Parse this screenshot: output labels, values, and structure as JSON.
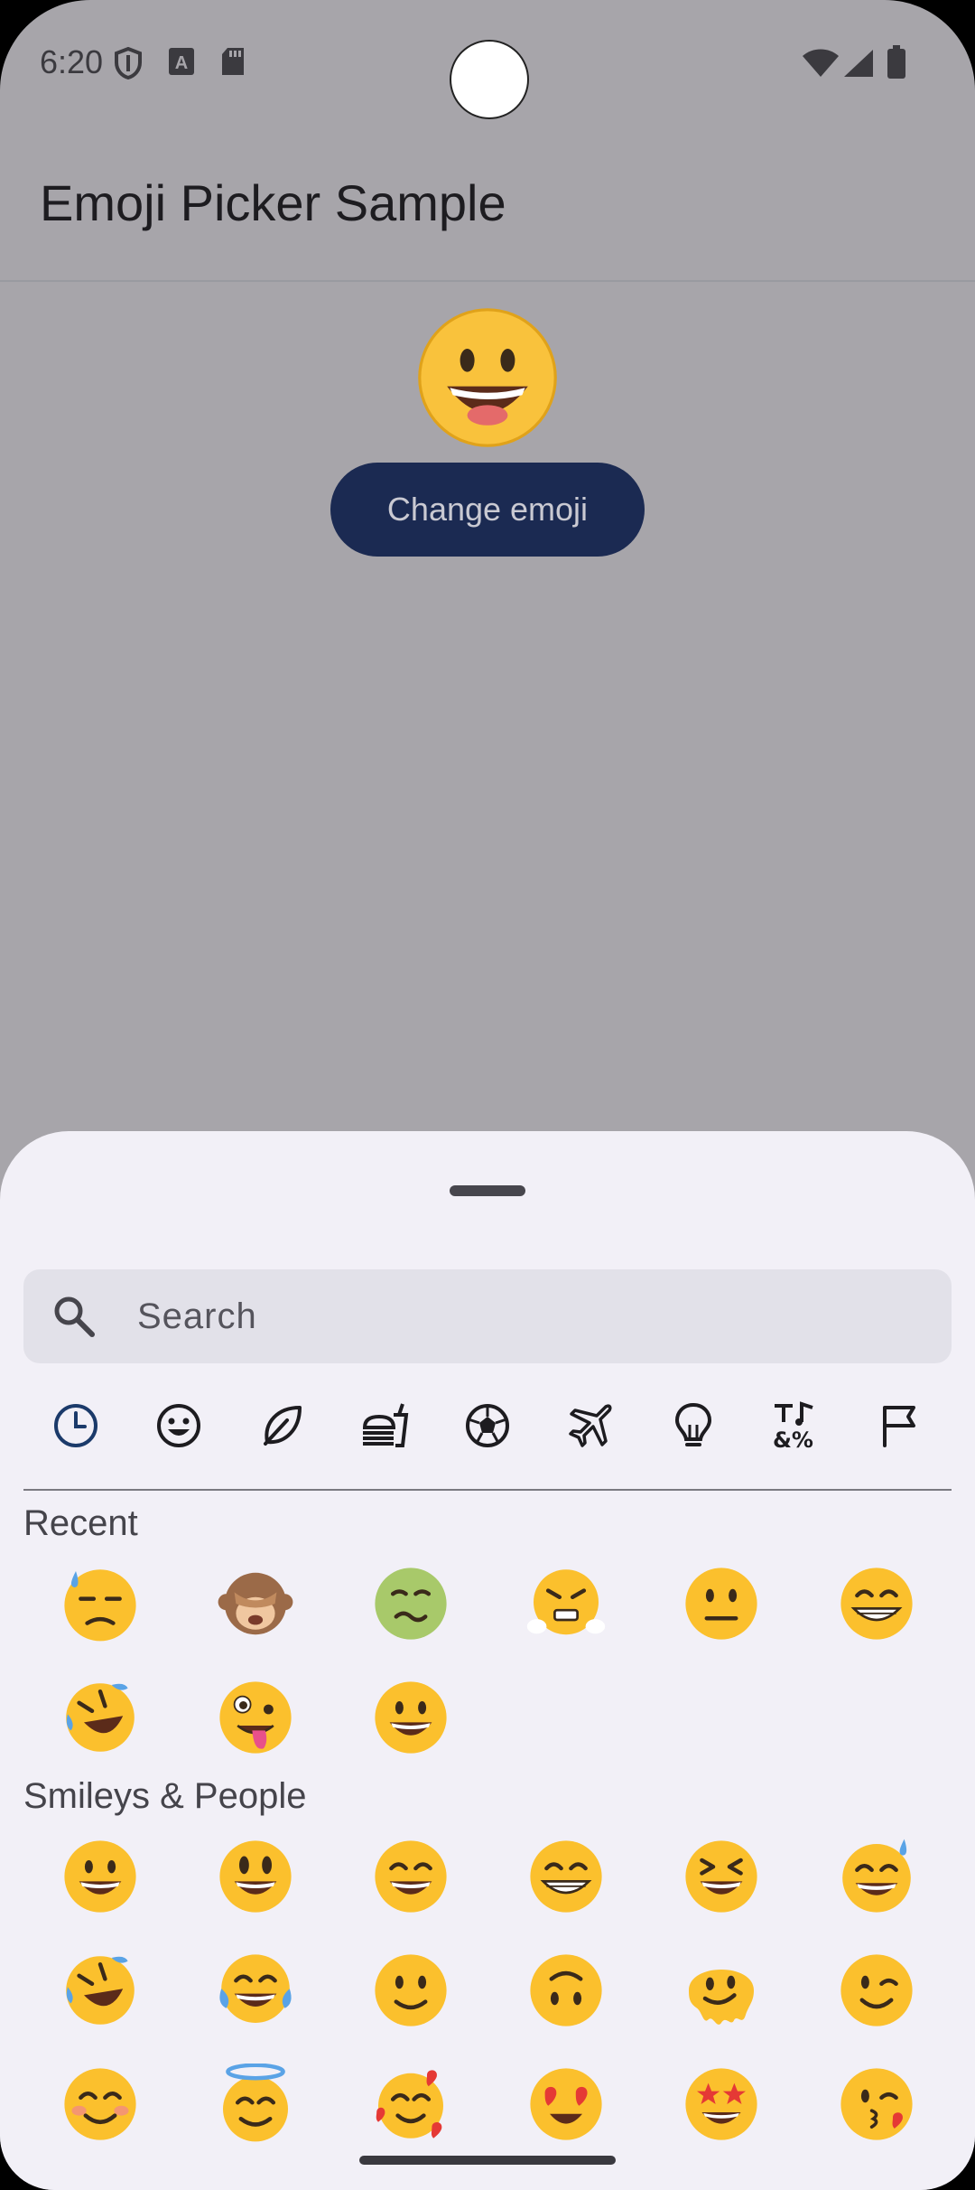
{
  "status_bar": {
    "time": "6:20",
    "left_icons": [
      "shield-icon",
      "font-download-icon",
      "sd-card-icon"
    ],
    "right_icons": [
      "wifi-icon",
      "cell-signal-icon",
      "battery-icon"
    ]
  },
  "app_bar": {
    "title": "Emoji Picker Sample"
  },
  "main": {
    "selected_emoji": "grinning-face",
    "change_button_label": "Change emoji",
    "button_color": "#1b2a52"
  },
  "sheet": {
    "search": {
      "placeholder": "Search"
    },
    "category_tabs": [
      {
        "name": "recent",
        "icon": "clock-icon",
        "selected": true
      },
      {
        "name": "smileys",
        "icon": "smiley-icon"
      },
      {
        "name": "nature",
        "icon": "leaf-icon"
      },
      {
        "name": "food",
        "icon": "food-icon"
      },
      {
        "name": "activities",
        "icon": "soccer-ball-icon"
      },
      {
        "name": "travel",
        "icon": "airplane-icon"
      },
      {
        "name": "objects",
        "icon": "lightbulb-icon"
      },
      {
        "name": "symbols",
        "icon": "symbols-icon"
      },
      {
        "name": "flags",
        "icon": "flag-icon"
      }
    ],
    "sections": [
      {
        "label": "Recent",
        "emojis": [
          "downcast-face-with-sweat",
          "see-no-evil-monkey",
          "nauseated-face",
          "face-with-steam",
          "neutral-face",
          "beaming-face",
          "rolling-on-floor-laughing",
          "zany-face",
          "grinning-face"
        ]
      },
      {
        "label": "Smileys & People",
        "emojis": [
          "grinning-face",
          "grinning-face-big-eyes",
          "grinning-face-smiling-eyes",
          "beaming-face",
          "grinning-squinting-face",
          "grinning-face-with-sweat",
          "rolling-on-floor-laughing",
          "face-with-tears-of-joy",
          "slightly-smiling-face",
          "upside-down-face",
          "melting-face",
          "winking-face",
          "smiling-face-smiling-eyes",
          "smiling-face-with-halo",
          "smiling-face-with-hearts",
          "smiling-face-heart-eyes",
          "star-struck",
          "face-blowing-kiss"
        ]
      }
    ]
  },
  "colors": {
    "scrim": "#a7a5aa",
    "sheet": "#f2f0f7",
    "emoji_yellow": "#fbc02d",
    "accent": "#1b2a52"
  }
}
